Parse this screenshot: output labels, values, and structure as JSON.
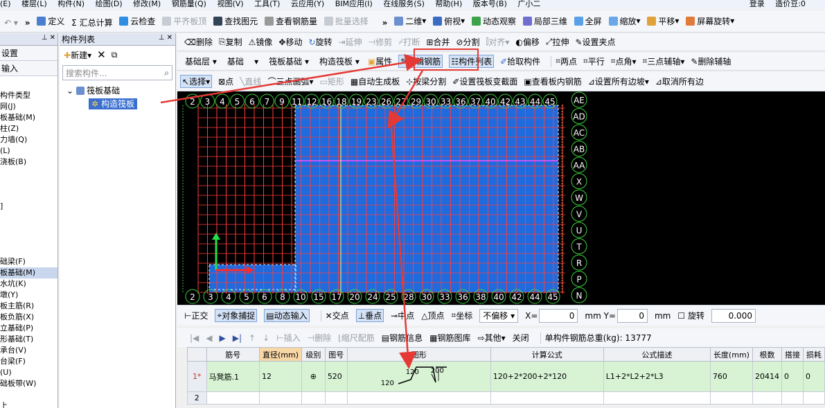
{
  "menubar": {
    "items": [
      "(E)",
      "楼层(L)",
      "构件(N)",
      "绘图(D)",
      "修改(M)",
      "钢筋量(Q)",
      "视图(V)",
      "工具(T)",
      "云应用(Y)",
      "BIM应用(I)",
      "在线服务(S)",
      "帮助(H)",
      "版本号(B)",
      "广小二"
    ],
    "login": "登录",
    "beans": "造价豆:0"
  },
  "toolbar1": {
    "items": [
      "定义",
      "Σ 汇总计算",
      "云检查",
      "平齐板顶",
      "查找图元",
      "查看钢筋量",
      "批量选择",
      "二维",
      "俯视",
      "动态观察",
      "局部三维",
      "全屏",
      "缩放",
      "平移",
      "屏幕旋转"
    ]
  },
  "left_panel": {
    "title_suffix": "设置",
    "row2": "输入",
    "items": [
      "构件类型",
      "网(J)",
      "板基础(M)",
      "柱(Z)",
      "力墙(Q)",
      "(L)",
      "浇板(B)",
      "",
      "",
      "",
      "]",
      "",
      "",
      "",
      "",
      "础梁(F)",
      "板基础(M)",
      "水坑(K)",
      "墩(Y)",
      "板主筋(R)",
      "板负筋(X)",
      "立基础(P)",
      "形基础(T)",
      "承台(V)",
      "台梁(F)",
      "(U)",
      "础板带(W)",
      "",
      "上"
    ]
  },
  "component_list": {
    "title": "构件列表",
    "new_label": "新建",
    "search_placeholder": "搜索构件...",
    "tree_root": "筏板基础",
    "tree_leaf": "构造筏板"
  },
  "edit_toolbar": {
    "items": [
      "删除",
      "复制",
      "镜像",
      "移动",
      "旋转",
      "延伸",
      "修剪",
      "打断",
      "合并",
      "分割",
      "对齐",
      "偏移",
      "拉伸",
      "设置夹点"
    ]
  },
  "layer_toolbar": {
    "layer": "基础层",
    "category": "基础",
    "type": "筏板基础",
    "component": "构造筏板",
    "items": [
      "属性",
      "编辑钢筋",
      "构件列表",
      "拾取构件",
      "两点",
      "平行",
      "点角",
      "三点辅轴",
      "删除辅轴"
    ]
  },
  "draw_toolbar": {
    "items": [
      "选择",
      "点",
      "直线",
      "三点画弧",
      "矩形",
      "自动生成板",
      "按梁分割",
      "设置筏板变截面",
      "查看板内钢筋",
      "设置所有边坡",
      "取消所有边"
    ]
  },
  "canvas": {
    "top_axis": [
      "2",
      "3",
      "4",
      "5",
      "6",
      "7",
      "9",
      "11",
      "12",
      "16",
      "18",
      "19",
      "23",
      "26",
      "27",
      "29",
      "30",
      "33",
      "36",
      "37",
      "40",
      "42",
      "43",
      "44",
      "45"
    ],
    "bottom_axis": [
      "2",
      "3",
      "4",
      "5",
      "6",
      "8",
      "10",
      "15",
      "17",
      "20",
      "24",
      "25",
      "28",
      "30",
      "33",
      "36",
      "38",
      "40",
      "42",
      "44",
      "45"
    ],
    "right_axis": [
      "AE",
      "AD",
      "AC",
      "AB",
      "AA",
      "X",
      "W",
      "V",
      "U",
      "T",
      "R",
      "P",
      "N"
    ]
  },
  "snap_bar": {
    "items": [
      "正交",
      "对象捕捉",
      "动态输入",
      "交点",
      "垂点",
      "中点",
      "顶点",
      "坐标"
    ],
    "offset": "不偏移",
    "x_label": "X=",
    "x_value": "0",
    "y_label": "mm Y=",
    "y_value": "0",
    "mm": "mm",
    "rotate_label": "旋转",
    "rotate_value": "0.000"
  },
  "rebar_toolbar": {
    "items": [
      "插入",
      "删除",
      "缩尺配筋",
      "钢筋信息",
      "钢筋图库",
      "其他",
      "关闭"
    ],
    "total": "单构件钢筋总重(kg): 13777"
  },
  "rebar_table": {
    "headers": [
      "",
      "筋号",
      "直径(mm)",
      "级别",
      "图号",
      "图形",
      "计算公式",
      "公式描述",
      "长度(mm)",
      "根数",
      "搭接",
      "损耗"
    ],
    "rows": [
      {
        "no": "1*",
        "name": "马凳筋.1",
        "dia": "12",
        "grade": "⊕",
        "fig": "520",
        "shape_a": "120",
        "shape_b": "200",
        "shape_c": "120",
        "formula": "120+2*200+2*120",
        "desc": "L1+2*L2+2*L3",
        "length": "760",
        "count": "20414",
        "lap": "0",
        "loss": "0"
      },
      {
        "no": "2",
        "name": "",
        "dia": "",
        "grade": "",
        "fig": "",
        "shape_a": "",
        "shape_b": "",
        "shape_c": "",
        "formula": "",
        "desc": "",
        "length": "",
        "count": "",
        "lap": "",
        "loss": ""
      }
    ]
  },
  "colors": {
    "accent": "#e53935",
    "slab": "#1e6be0",
    "grid": "#ff3b3b",
    "axis": "#3fd13f"
  }
}
